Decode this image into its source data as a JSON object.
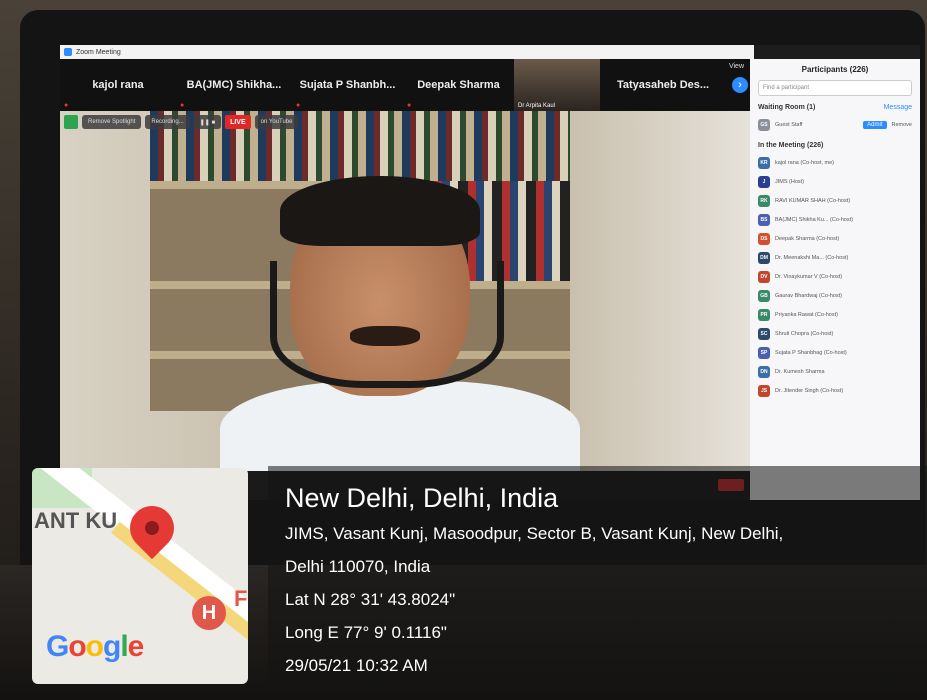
{
  "zoom": {
    "window_title": "Zoom Meeting",
    "view_label": "View",
    "gallery": [
      {
        "name": "kajol rana"
      },
      {
        "name": "BA(JMC) Shikha..."
      },
      {
        "name": "Sujata P Shanbh..."
      },
      {
        "name": "Deepak Sharma"
      },
      {
        "name": "Dr Arpita Kaul",
        "camera": true
      },
      {
        "name": "Tatyasaheb Des..."
      }
    ],
    "controls": {
      "spotlight": "Remove Spotlight",
      "recording": "Recording...",
      "live": "LIVE",
      "youtube": "on YouTube"
    },
    "participants": {
      "title": "Participants (226)",
      "search_placeholder": "Find a participant",
      "waiting_room": "Waiting Room (1)",
      "message": "Message",
      "waiting_guest": "Guest Staff",
      "admit": "Admit",
      "remove": "Remove",
      "in_meeting": "In the Meeting (226)",
      "rows": [
        {
          "initials": "KR",
          "name": "kajol rana (Co-host, me)",
          "color": "#3b6ea8"
        },
        {
          "initials": "J",
          "name": "JIMS (Host)",
          "color": "#2c3e91"
        },
        {
          "initials": "RK",
          "name": "RAVI KUMAR SHAH (Co-host)",
          "color": "#3a8a6a"
        },
        {
          "initials": "BS",
          "name": "BA(JMC) Shikha Ku... (Co-host)",
          "color": "#4a5fb0"
        },
        {
          "initials": "DS",
          "name": "Deepak Sharma (Co-host)",
          "color": "#d2502e"
        },
        {
          "initials": "DM",
          "name": "Dr. Meenakshi Ma... (Co-host)",
          "color": "#2e4a6a"
        },
        {
          "initials": "DV",
          "name": "Dr. Vinaykumar V (Co-host)",
          "color": "#c0472e"
        },
        {
          "initials": "GB",
          "name": "Gaurav Bhardwaj (Co-host)",
          "color": "#3a8a6a"
        },
        {
          "initials": "PR",
          "name": "Priyanka Rawat (Co-host)",
          "color": "#3a8a6a"
        },
        {
          "initials": "SC",
          "name": "Shruti Chopra (Co-host)",
          "color": "#2e4a6a"
        },
        {
          "initials": "SP",
          "name": "Sujata P Shanbhag (Co-host)",
          "color": "#4a5fb0"
        },
        {
          "initials": "DN",
          "name": "Dr. Kumesh Sharma",
          "color": "#3b6ea8"
        },
        {
          "initials": "JS",
          "name": "Dr. Jitender Singh (Co-host)",
          "color": "#c0472e"
        }
      ]
    }
  },
  "geotag": {
    "city": "New Delhi, Delhi, India",
    "address_line1": "JIMS, Vasant Kunj, Masoodpur, Sector B, Vasant Kunj, New Delhi,",
    "address_line2": "Delhi 110070, India",
    "lat": "Lat N 28° 31' 43.8024\"",
    "long": "Long E 77° 9' 0.1116\"",
    "datetime": "29/05/21 10:32 AM",
    "map_label": "ANT KU",
    "map_label2": "F",
    "hospital_glyph": "H",
    "google": [
      "G",
      "o",
      "o",
      "g",
      "l",
      "e"
    ]
  }
}
